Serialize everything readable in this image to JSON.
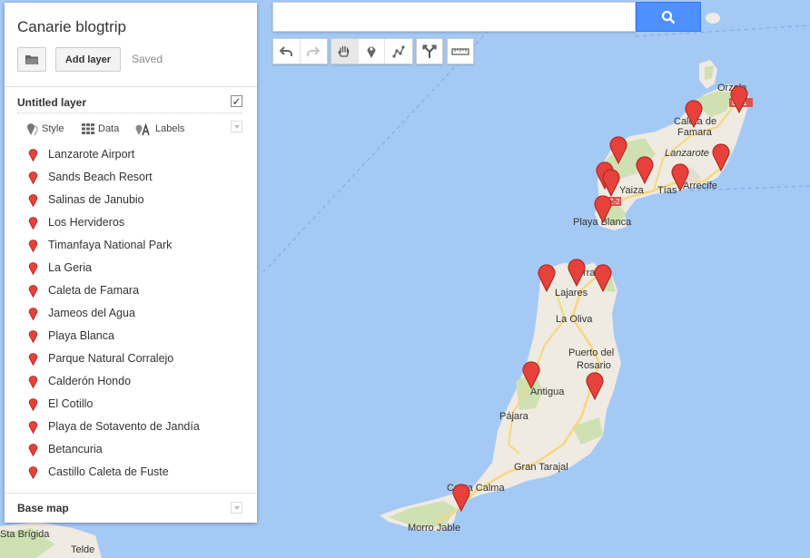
{
  "panel": {
    "map_title": "Canarie blogtrip",
    "add_layer_label": "Add layer",
    "saved_status": "Saved",
    "layer": {
      "title": "Untitled layer",
      "checked": true,
      "tools": {
        "style": "Style",
        "data": "Data",
        "labels": "Labels"
      }
    },
    "places": [
      "Lanzarote Airport",
      "Sands Beach Resort",
      "Salinas de Janubio",
      "Los Hervideros",
      "Timanfaya National Park",
      "La Geria",
      "Caleta de Famara",
      "Jameos del Agua",
      "Playa Blanca",
      "Parque Natural Corralejo",
      "Calderón Hondo",
      "El Cotillo",
      "Playa de Sotavento de Jandía",
      "Betancuria",
      "Castillo Caleta de Fuste"
    ],
    "base_map_label": "Base map"
  },
  "search": {
    "value": "",
    "placeholder": ""
  },
  "toolbar": {
    "icons": [
      "undo-icon",
      "redo-icon",
      "hand-icon",
      "marker-icon",
      "line-icon",
      "directions-icon",
      "ruler-icon"
    ],
    "active": "hand-icon"
  },
  "map": {
    "labels": {
      "orzola": "Orzola",
      "caleta": "Caleta de",
      "famara": "Famara",
      "lanzarote": "Lanzarote",
      "yaiza": "Yaiza",
      "tias": "Tías",
      "arrecife": "Arrecife",
      "playa_blanca": "Playa Blanca",
      "corralejo": "Corralejo",
      "lajares": "Lajares",
      "la_oliva": "La Oliva",
      "puerto1": "Puerto del",
      "puerto2": "Rosario",
      "antigua": "Antigua",
      "pajara": "Pájara",
      "gran_tarajal": "Gran Tarajal",
      "costa_calma": "Costa Calma",
      "morro_jable": "Morro Jable",
      "santa_brigida": "Sta Brígida",
      "telde": "Telde",
      "road_lz1": "LZ-1",
      "road_lz2": "LZ-2"
    },
    "colors": {
      "sea": "#a5c9f5",
      "land": "#efebe2",
      "green": "#cfe0b2",
      "road": "#f5d77f",
      "marker": "#e6413a"
    }
  }
}
